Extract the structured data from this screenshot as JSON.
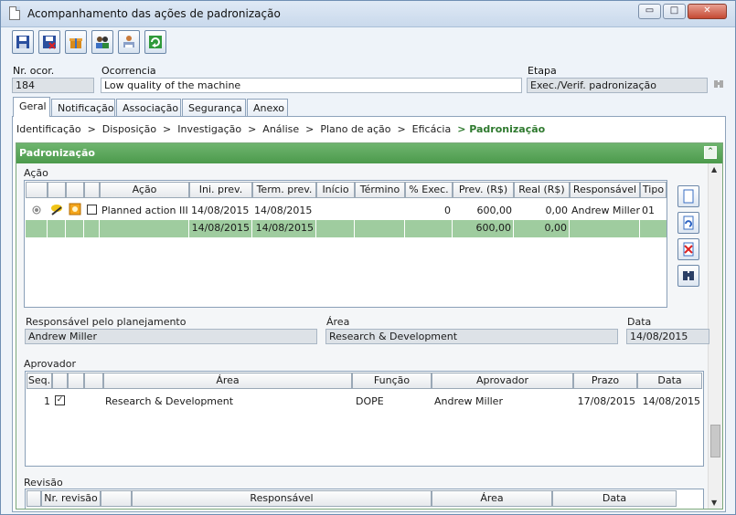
{
  "window": {
    "title": "Acompanhamento das ações de padronização",
    "minimize": "▭",
    "maximize": "□",
    "close": "✕"
  },
  "toolbar": {
    "icons": [
      "save-icon",
      "save-close-icon",
      "gift-icon",
      "users-icon",
      "print-icon",
      "refresh-icon"
    ]
  },
  "header": {
    "nr_label": "Nr. ocor.",
    "nr_value": "184",
    "ocorrencia_label": "Ocorrencia",
    "ocorrencia_value": "Low quality of the machine",
    "etapa_label": "Etapa",
    "etapa_value": "Exec./Verif. padronização"
  },
  "tabs": [
    "Geral",
    "Notificação",
    "Associação",
    "Segurança",
    "Anexo"
  ],
  "breadcrumb": {
    "steps": "Identificação  >  Disposição  >  Investigação  >  Análise  >  Plano de ação  >  Eficácia  ",
    "current": "> Padronização"
  },
  "section": {
    "title": "Padronização",
    "collapse_glyph": "⌃"
  },
  "acao": {
    "label": "Ação",
    "columns": [
      "",
      "",
      "",
      "",
      "Ação",
      "Ini. prev.",
      "Term. prev.",
      "Início",
      "Término",
      "% Exec.",
      "Prev. (R$)",
      "Real (R$)",
      "Responsável",
      "Tipo"
    ],
    "rows": [
      {
        "acao": "Planned action III",
        "ini_prev": "14/08/2015",
        "term_prev": "14/08/2015",
        "inicio": "",
        "termino": "",
        "exec": "0",
        "prev": "600,00",
        "real": "0,00",
        "responsavel": "Andrew Miller",
        "tipo": "01"
      }
    ],
    "totals": {
      "ini_prev": "14/08/2015",
      "term_prev": "14/08/2015",
      "prev": "600,00",
      "real": "0,00"
    }
  },
  "planning": {
    "resp_label": "Responsável pelo planejamento",
    "resp_value": "Andrew Miller",
    "area_label": "Área",
    "area_value": "Research & Development",
    "data_label": "Data",
    "data_value": "14/08/2015"
  },
  "aprovador": {
    "label": "Aprovador",
    "columns": [
      "Seq.",
      "",
      "",
      "",
      "Área",
      "Função",
      "Aprovador",
      "Prazo",
      "Data"
    ],
    "rows": [
      {
        "seq": "1",
        "checked": "✓",
        "area": "Research & Development",
        "funcao": "DOPE",
        "aprovador": "Andrew Miller",
        "prazo": "17/08/2015",
        "data": "14/08/2015"
      }
    ]
  },
  "revisao": {
    "label": "Revisão",
    "columns": [
      "Nr. revisão",
      "Responsável",
      "Área",
      "Data"
    ]
  },
  "colors": {
    "accent_green": "#4c9a4c",
    "total_row": "#9fcc9f",
    "breadcrumb_current": "#2f7a2f"
  }
}
